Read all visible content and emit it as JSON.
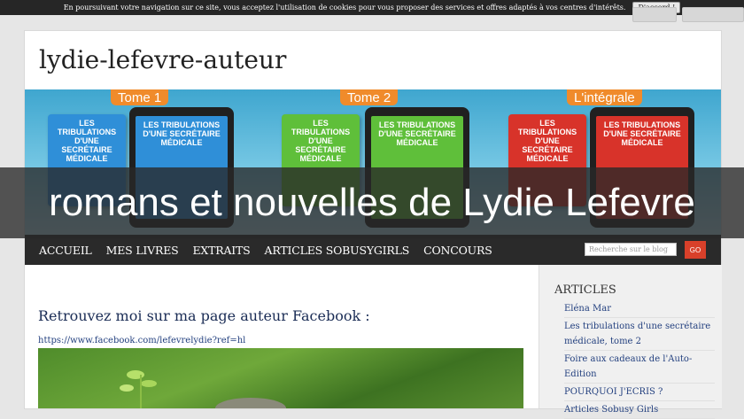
{
  "cookie_bar": {
    "text": "En poursuivant votre navigation sur ce site, vous acceptez l'utilisation de cookies pour vous proposer des services et offres adaptés à vos centres d'intérêts.",
    "accept_label": "D'accord !"
  },
  "site": {
    "title": "lydie-lefevre-auteur"
  },
  "banner": {
    "tome1_label": "Tome 1",
    "tome2_label": "Tome 2",
    "integrale_label": "L'intégrale",
    "cover_text": "LES TRIBULATIONS D'UNE SECRÉTAIRE MÉDICALE"
  },
  "overlay": {
    "text": "romans et nouvelles de Lydie Lefevre"
  },
  "nav": {
    "items": [
      "ACCUEIL",
      "MES LIVRES",
      "EXTRAITS",
      "ARTICLES SOBUSYGIRLS",
      "CONCOURS"
    ],
    "search_placeholder": "Recherche sur le blog",
    "go_label": "GO"
  },
  "content": {
    "heading": "Retrouvez moi sur ma page auteur Facebook :",
    "link": "https://www.facebook.com/lefevrelydie?ref=hl"
  },
  "sidebar": {
    "title": "ARTICLES",
    "items": [
      "Eléna Mar",
      "Les tribulations d'une secrétaire médicale, tome 2",
      "Foire aux cadeaux de l'Auto-Edition",
      "POURQUOI J'ECRIS ?",
      "Articles Sobusy Girls"
    ]
  },
  "colors": {
    "nav_bg": "#2a2a2a",
    "go_button": "#d8402a",
    "tome_label": "#f08b2b",
    "link": "#23407f"
  }
}
